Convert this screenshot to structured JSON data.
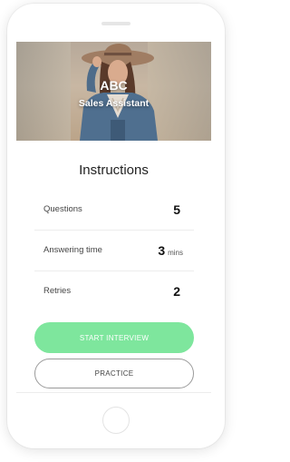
{
  "hero": {
    "title": "ABC",
    "subtitle": "Sales Assistant"
  },
  "instructions": {
    "title": "Instructions",
    "rows": [
      {
        "label": "Questions",
        "value": "5",
        "unit": ""
      },
      {
        "label": "Answering time",
        "value": "3",
        "unit": "mins"
      },
      {
        "label": "Retries",
        "value": "2",
        "unit": ""
      }
    ]
  },
  "actions": {
    "start_label": "START INTERVIEW",
    "practice_label": "PRACTICE"
  },
  "colors": {
    "accent": "#7ee69d",
    "outline": "#9a9a9a"
  }
}
